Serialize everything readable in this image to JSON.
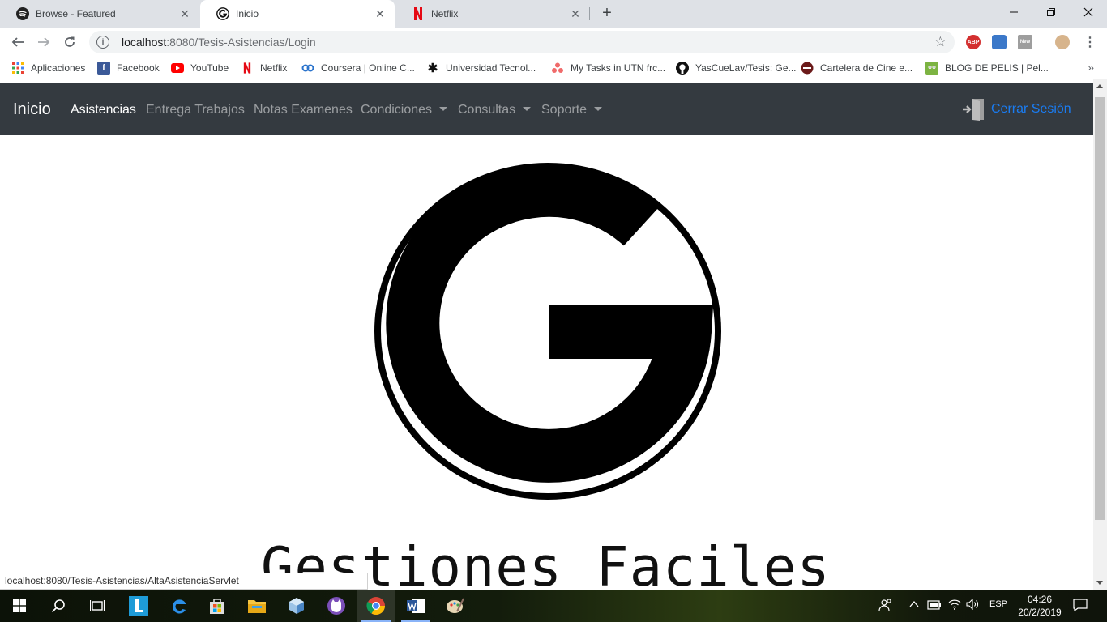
{
  "browser": {
    "tabs": [
      {
        "title": "Browse - Featured",
        "icon": "spotify-icon",
        "active": false
      },
      {
        "title": "Inicio",
        "icon": "g-logo-icon",
        "active": true
      },
      {
        "title": "Netflix",
        "icon": "netflix-icon",
        "active": false
      }
    ],
    "url_host": "localhost",
    "url_rest": ":8080/Tesis-Asistencias/Login",
    "status_url": "localhost:8080/Tesis-Asistencias/AltaAsistenciaServlet",
    "extensions": [
      "adblock-icon",
      "cube-extension-icon",
      "new-extension-icon",
      "profile-avatar-icon"
    ],
    "extension_labels": {
      "abp": "ABP",
      "new": "New"
    }
  },
  "bookmarks": [
    {
      "label": "Aplicaciones",
      "icon": "apps-grid-icon"
    },
    {
      "label": "Facebook",
      "icon": "facebook-icon"
    },
    {
      "label": "YouTube",
      "icon": "youtube-icon"
    },
    {
      "label": "Netflix",
      "icon": "netflix-icon"
    },
    {
      "label": "Coursera | Online C...",
      "icon": "coursera-icon"
    },
    {
      "label": "Universidad Tecnol...",
      "icon": "utn-icon"
    },
    {
      "label": "My Tasks in UTN frc...",
      "icon": "asana-icon"
    },
    {
      "label": "YasCueLav/Tesis: Ge...",
      "icon": "github-icon"
    },
    {
      "label": "Cartelera de Cine e...",
      "icon": "cinema-icon"
    },
    {
      "label": "BLOG DE PELIS | Pel...",
      "icon": "blog-icon"
    }
  ],
  "navbar": {
    "brand": "Inicio",
    "links": [
      "Asistencias",
      "Entrega Trabajos",
      "Notas Examenes"
    ],
    "dropdowns": [
      "Condiciones",
      "Consultas",
      "Soporte"
    ],
    "logout": "Cerrar Sesión"
  },
  "main": {
    "logo_text": "Gestiones Faciles"
  },
  "taskbar": {
    "apps": [
      "windows-start-icon",
      "search-icon",
      "task-view-icon",
      "l-app-icon",
      "edge-icon",
      "store-icon",
      "file-explorer-icon",
      "cube-app-icon",
      "cat-app-icon",
      "chrome-icon",
      "word-icon",
      "paint-icon"
    ],
    "language": "ESP",
    "time": "04:26",
    "date": "20/2/2019"
  },
  "colors": {
    "navbar_bg": "#343a40",
    "logout_link": "#1a7cf2",
    "tabstrip_bg": "#dee1e6"
  }
}
